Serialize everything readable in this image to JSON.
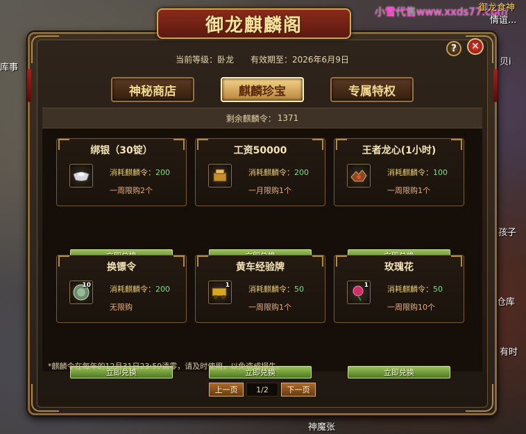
{
  "background": {
    "watermark": "小雪代售www.xxds77.com",
    "labels": [
      {
        "name": "left-label-1",
        "text": "库事"
      },
      {
        "name": "right-label-1",
        "text": "御龙食神"
      },
      {
        "name": "right-label-2",
        "text": "情谊..."
      },
      {
        "name": "right-label-3",
        "text": "贝i"
      },
      {
        "name": "right-label-4",
        "text": "孩子"
      },
      {
        "name": "right-label-5",
        "text": "仓库"
      },
      {
        "name": "right-label-6",
        "text": "有时"
      },
      {
        "name": "bottom-label-1",
        "text": "神魔张"
      }
    ]
  },
  "window": {
    "title": "御龙麒麟阁",
    "current_level_label": "当前等级：卧龙",
    "expiry_label": "有效期至：2026年6月9日",
    "help_icon": "?",
    "close_icon": "✕"
  },
  "tabs": [
    {
      "label": "神秘商店",
      "active": false
    },
    {
      "label": "麒麟珍宝",
      "active": true
    },
    {
      "label": "专属特权",
      "active": false
    }
  ],
  "remaining": {
    "label": "剩余麒麟令：",
    "value": "1371"
  },
  "items": [
    {
      "title": "绑银（30锭）",
      "cost_label": "消耗麒麟令：",
      "cost": "200",
      "limit": "一周限购2个",
      "qty": "",
      "icon": "silver-ingot-icon",
      "button": "立即兑换"
    },
    {
      "title": "工资50000",
      "cost_label": "消耗麒麟令：",
      "cost": "200",
      "limit": "一月限购1个",
      "qty": "",
      "icon": "salary-box-icon",
      "button": "立即兑换"
    },
    {
      "title": "王者龙心(1小时)",
      "cost_label": "消耗麒麟令：",
      "cost": "100",
      "limit": "一周限购1个",
      "qty": "",
      "icon": "dragon-heart-icon",
      "button": "立即兑换"
    },
    {
      "title": "换镖令",
      "cost_label": "消耗麒麟令：",
      "cost": "200",
      "limit": "无限购",
      "qty": "10",
      "icon": "escort-token-icon",
      "button": "立即兑换"
    },
    {
      "title": "黄车经验牌",
      "cost_label": "消耗麒麟令：",
      "cost": "50",
      "limit": "一周限购1个",
      "qty": "1",
      "icon": "yellow-cart-exp-icon",
      "button": "立即兑换"
    },
    {
      "title": "玫瑰花",
      "cost_label": "消耗麒麟令：",
      "cost": "50",
      "limit": "一周限购10个",
      "qty": "1",
      "icon": "rose-icon",
      "button": "立即兑换"
    }
  ],
  "note": "*麒麟令在每年的12月31日23:59清零，请及时使用，以免造成损失。",
  "pager": {
    "prev": "上一页",
    "page": "1/2",
    "next": "下一页"
  }
}
